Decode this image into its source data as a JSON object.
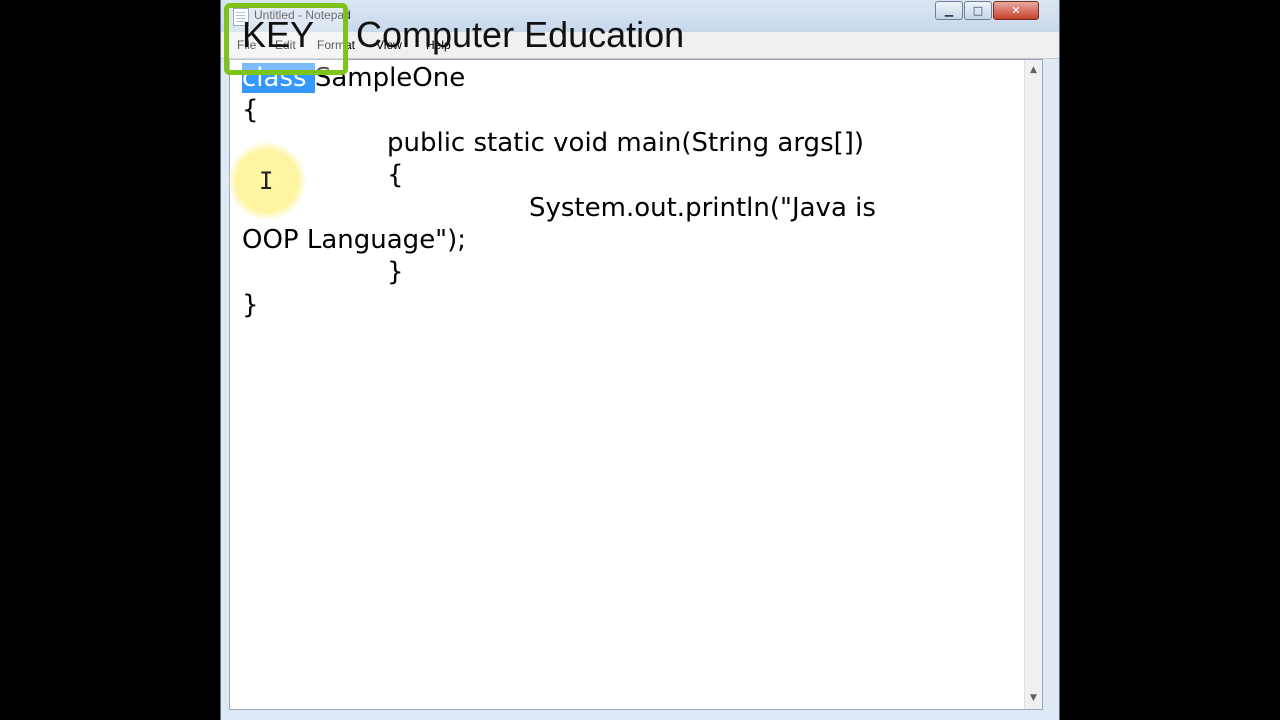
{
  "window": {
    "title": "Untitled - Notepad",
    "controls": {
      "minimize": "▁",
      "maximize": "□",
      "close": "✕"
    }
  },
  "menu": [
    "File",
    "Edit",
    "Format",
    "View",
    "Help"
  ],
  "editor": {
    "lines": [
      "class SampleOne",
      "{",
      "public static void main(String args[])",
      "{",
      "System.out.println(\"Java is",
      "OOP Language\");",
      "}",
      "}"
    ],
    "selected_text": "class ",
    "after_selection": "SampleOne"
  },
  "watermark": {
    "brand": "KEY",
    "tagline": "Computer Education",
    "accent": "#7dc31a"
  },
  "scrollbar": {
    "up": "▲",
    "down": "▼"
  }
}
